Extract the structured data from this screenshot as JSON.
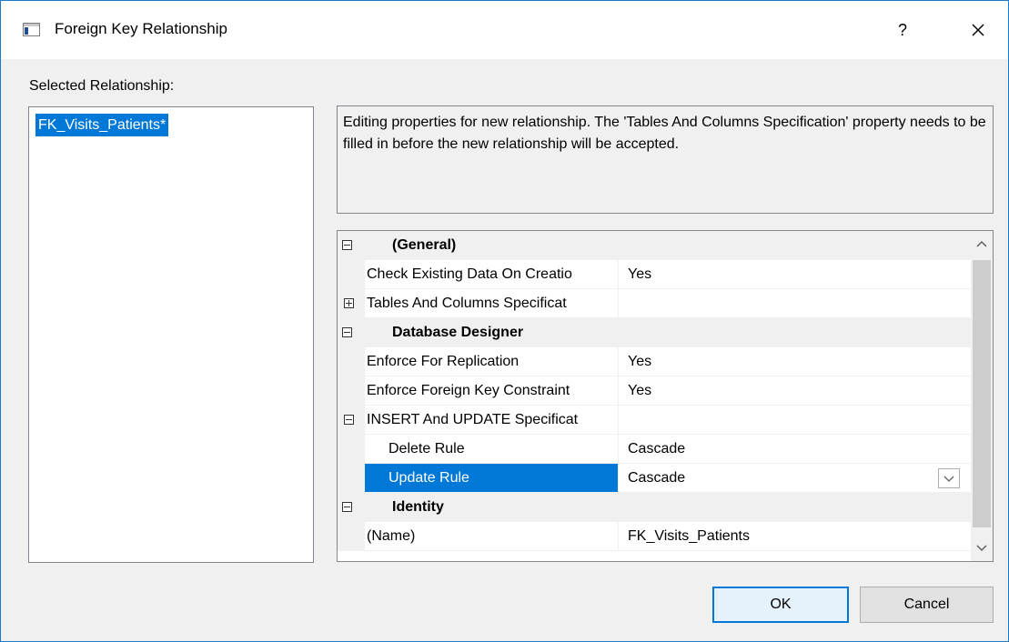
{
  "window": {
    "title": "Foreign Key Relationship",
    "help_label": "?",
    "close_icon": "close-icon",
    "app_icon": "dialog-window-icon"
  },
  "selected_relationship": {
    "label": "Selected Relationship:",
    "items": [
      {
        "label": "FK_Visits_Patients*",
        "selected": true
      }
    ]
  },
  "description": "Editing properties for new relationship.  The 'Tables And Columns Specification' property needs to be filled in before the new relationship will be accepted.",
  "property_grid": {
    "rows": [
      {
        "type": "category",
        "label": "(General)",
        "toggle": "collapse"
      },
      {
        "type": "property",
        "label": "Check Existing Data On Creatio",
        "value": "Yes"
      },
      {
        "type": "property",
        "label": "Tables And Columns Specificat",
        "value": "",
        "toggle": "expand"
      },
      {
        "type": "category",
        "label": "Database Designer",
        "toggle": "collapse"
      },
      {
        "type": "property",
        "label": "Enforce For Replication",
        "value": "Yes"
      },
      {
        "type": "property",
        "label": "Enforce Foreign Key Constraint",
        "value": "Yes"
      },
      {
        "type": "property",
        "label": "INSERT And UPDATE Specificat",
        "value": "",
        "toggle": "collapse"
      },
      {
        "type": "subproperty",
        "label": "Delete Rule",
        "value": "Cascade"
      },
      {
        "type": "subproperty",
        "label": "Update Rule",
        "value": "Cascade",
        "selected": true,
        "dropdown_icon": "chevron-down-icon"
      },
      {
        "type": "category",
        "label": "Identity",
        "toggle": "collapse"
      },
      {
        "type": "property",
        "label": "(Name)",
        "value": "FK_Visits_Patients"
      }
    ],
    "scroll_position": 0
  },
  "buttons": {
    "ok_label": "OK",
    "cancel_label": "Cancel"
  },
  "colors": {
    "selection": "#0078d7",
    "accent_border": "#0078d7"
  }
}
